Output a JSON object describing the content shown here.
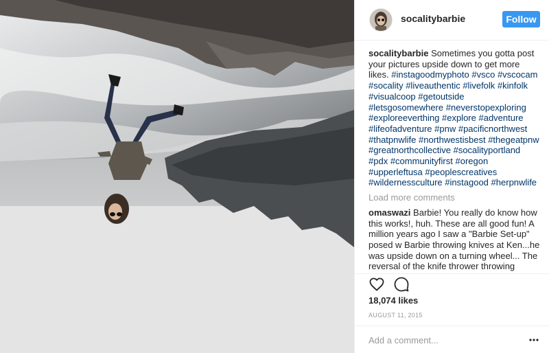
{
  "post": {
    "username": "socalitybarbie",
    "follow_label": "Follow",
    "caption": {
      "text": "Sometimes you gotta post your pictures upside down to get more likes.",
      "hashtags": [
        "#instagoodmyphoto",
        "#vsco",
        "#vscocam",
        "#socality",
        "#liveauthentic",
        "#livefolk",
        "#kinfolk",
        "#visualcoop",
        "#getoutside",
        "#letsgosomewhere",
        "#neverstopexploring",
        "#exploreeverthing",
        "#explore",
        "#adventure",
        "#lifeofadventure",
        "#pnw",
        "#pacificnorthwest",
        "#thatpnwlife",
        "#northwestisbest",
        "#thegeatpnw",
        "#greatnorthcollective",
        "#socalityportland",
        "#pdx",
        "#communityfirst",
        "#oregon",
        "#upperleftusa",
        "#peoplescreatives",
        "#wildernessculture",
        "#instagood",
        "#herpnwlife"
      ]
    },
    "load_more_label": "Load more comments",
    "comments": [
      {
        "username": "omaswazi",
        "text": "Barbie! You really do know how this works!, huh. These are all good fun! A million years ago I saw a \"Barbie Set-up\" posed w Barbie throwing knives at Ken...he was upside down on a turning wheel... The reversal of the knife thrower throwing"
      }
    ],
    "likes_label": "18,074 likes",
    "date_label": "AUGUST 11, 2015",
    "add_comment_placeholder": "Add a comment..."
  },
  "icons": {
    "like": "heart-icon",
    "comment": "comment-icon",
    "more": "more-options-icon"
  },
  "colors": {
    "follow_button": "#3897f0",
    "hashtag": "#003569",
    "muted": "#999999"
  }
}
